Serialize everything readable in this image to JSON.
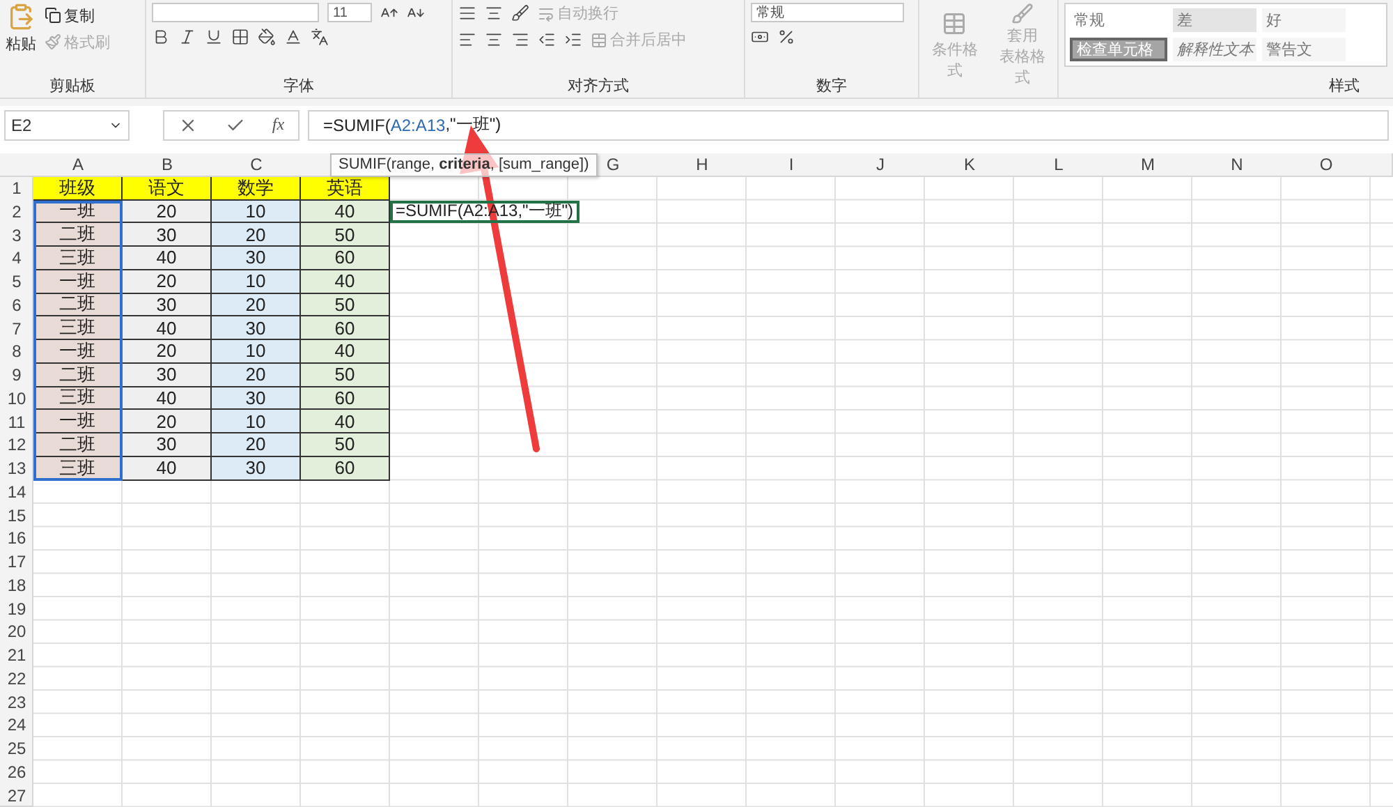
{
  "ribbon": {
    "groups": [
      {
        "kind": "clipboard",
        "label": "剪贴板",
        "paste": "粘贴",
        "copy": "复制",
        "painter": {
          "label": "格式刷",
          "disabled": true
        }
      },
      {
        "kind": "font",
        "label": "字体",
        "font_size": "11"
      },
      {
        "kind": "align",
        "label": "对齐方式",
        "wrap": "自动换行",
        "merge": "合并后居中"
      },
      {
        "kind": "number",
        "label": "数字",
        "format": "常规"
      },
      {
        "kind": "tables",
        "conditional": "条件格式",
        "table_format_1": "套用",
        "table_format_2": "表格格式"
      },
      {
        "kind": "styles",
        "label": "样式",
        "cells": [
          {
            "kind": "normal",
            "text": "常规",
            "color": "#ffffff"
          },
          {
            "kind": "bad",
            "text": "差",
            "color": "#e4e4e4"
          },
          {
            "kind": "good",
            "text": "好",
            "color": "#f5f5f5"
          },
          {
            "kind": "check",
            "text": "检查单元格",
            "color": "#a5a5a5"
          },
          {
            "kind": "explanatory",
            "text": "解释性文本",
            "color": "#f5f5f5"
          },
          {
            "kind": "warning",
            "text": "警告文",
            "color": "#f5f5f5"
          }
        ]
      }
    ]
  },
  "name_box": "E2",
  "formula_bar": {
    "fx": "fx",
    "parts": [
      {
        "kind": "plain",
        "text": "=SUMIF("
      },
      {
        "kind": "ref",
        "text": "A2:A13"
      },
      {
        "kind": "plain",
        "text": ",\"一班\")"
      }
    ]
  },
  "tooltip": "SUMIF(range, **criteria**, [sum_range])",
  "sheet": {
    "column_letters_left": [
      "A",
      "B",
      "C"
    ],
    "column_letters_right": [
      "G",
      "H",
      "I",
      "J",
      "K",
      "L",
      "M",
      "N",
      "O"
    ],
    "row_numbers": [
      "1",
      "2",
      "3",
      "4",
      "5",
      "6",
      "7",
      "8",
      "9",
      "10",
      "11",
      "12",
      "13",
      "14",
      "15",
      "16",
      "17",
      "18",
      "19",
      "20",
      "21",
      "22",
      "23",
      "24",
      "25",
      "26",
      "27"
    ],
    "header_row": {
      "color": "#ffff00",
      "cells": [
        "班级",
        "语文",
        "数学",
        "英语"
      ]
    },
    "columns": [
      {
        "color": "#e8dbd5",
        "selected": true
      },
      {
        "color": "#efefef",
        "selected": false
      },
      {
        "color": "#ddebf7",
        "selected": false
      },
      {
        "color": "#e2efda",
        "selected": false
      }
    ],
    "rows": [
      [
        "一班",
        "20",
        "10",
        "40"
      ],
      [
        "二班",
        "30",
        "20",
        "50"
      ],
      [
        "三班",
        "40",
        "30",
        "60"
      ],
      [
        "一班",
        "20",
        "10",
        "40"
      ],
      [
        "二班",
        "30",
        "20",
        "50"
      ],
      [
        "三班",
        "40",
        "30",
        "60"
      ],
      [
        "一班",
        "20",
        "10",
        "40"
      ],
      [
        "二班",
        "30",
        "20",
        "50"
      ],
      [
        "三班",
        "40",
        "30",
        "60"
      ],
      [
        "一班",
        "20",
        "10",
        "40"
      ],
      [
        "二班",
        "30",
        "20",
        "50"
      ],
      [
        "三班",
        "40",
        "30",
        "60"
      ]
    ],
    "editing_cell": "=SUMIF(A2:A13,\"一班\")"
  }
}
